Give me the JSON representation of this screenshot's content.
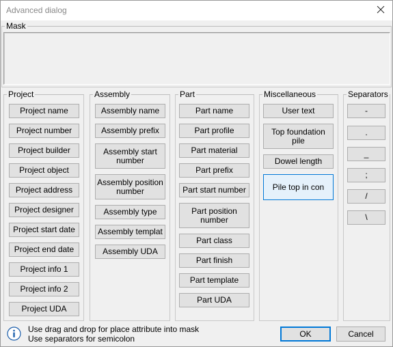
{
  "window": {
    "title": "Advanced dialog"
  },
  "mask": {
    "label": "Mask",
    "value": ""
  },
  "groups": {
    "project": {
      "label": "Project",
      "items": [
        "Project name",
        "Project number",
        "Project builder",
        "Project object",
        "Project address",
        "Project designer",
        "Project start date",
        "Project end date",
        "Project info 1",
        "Project info 2",
        "Project UDA"
      ]
    },
    "assembly": {
      "label": "Assembly",
      "items": [
        "Assembly name",
        "Assembly prefix",
        "Assembly start number",
        "Assembly position number",
        "Assembly type",
        "Assembly templat",
        "Assembly UDA"
      ]
    },
    "part": {
      "label": "Part",
      "items": [
        "Part name",
        "Part profile",
        "Part material",
        "Part prefix",
        "Part start number",
        "Part position number",
        "Part class",
        "Part finish",
        "Part template",
        "Part UDA"
      ]
    },
    "misc": {
      "label": "Miscellaneous",
      "items": [
        "User text",
        "Top foundation pile",
        "Dowel length",
        "Pile top in con"
      ],
      "selected_index": 3
    },
    "separators": {
      "label": "Separators",
      "items": [
        "-",
        ".",
        "_",
        ";",
        "/",
        "\\"
      ]
    }
  },
  "info": {
    "line1": "Use drag and drop for place attribute into mask",
    "line2": "Use separators for semicolon"
  },
  "buttons": {
    "ok": "OK",
    "cancel": "Cancel"
  },
  "colors": {
    "accent": "#0078d7",
    "button_bg": "#e1e1e1",
    "selected_bg": "#e5f1fb",
    "info_icon": "#1a5dab"
  },
  "icons": {
    "close": "close-icon",
    "info": "info-icon"
  }
}
